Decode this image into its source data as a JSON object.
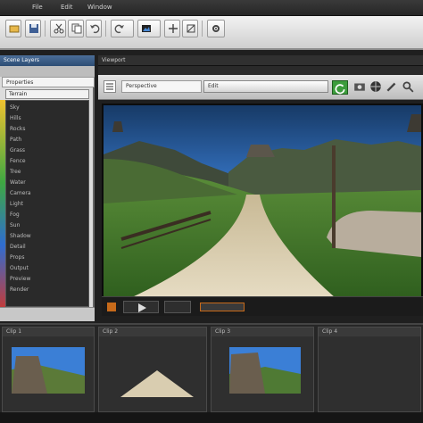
{
  "window": {
    "menu": [
      "File",
      "Edit",
      "Window"
    ]
  },
  "toolbar": {
    "buttons": [
      "open-icon",
      "save-icon",
      "cut-icon",
      "copy-icon",
      "undo-icon",
      "redo-icon",
      "render-icon",
      "settings-icon"
    ]
  },
  "left_panel": {
    "title": "Scene Layers",
    "subtitle": "Properties",
    "list_header": "Terrain",
    "items": [
      "Sky",
      "Hills",
      "Rocks",
      "Path",
      "Grass",
      "Fence",
      "Tree",
      "Water",
      "Camera",
      "Light",
      "Fog",
      "Sun",
      "Shadow",
      "Detail",
      "Props",
      "Output",
      "Preview",
      "Render"
    ]
  },
  "viewport": {
    "title": "Viewport",
    "field1": "Perspective",
    "field2": "Edit",
    "scene_caption": ""
  },
  "timeline": {
    "panes": [
      "Clip 1",
      "Clip 2",
      "Clip 3",
      "Clip 4"
    ]
  },
  "colors": {
    "accent": "#4b6e98",
    "sky": "#3b7fd6",
    "grass": "#3f7a2a",
    "path": "#d9cdb0"
  }
}
